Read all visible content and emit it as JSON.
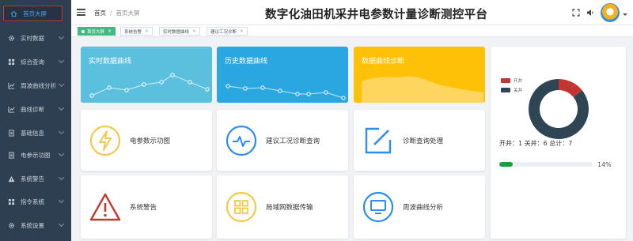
{
  "sidebar": {
    "items": [
      {
        "label": "首页大屏",
        "icon": "home-icon",
        "active": true
      },
      {
        "label": "实时数据",
        "icon": "gear-icon"
      },
      {
        "label": "综合查询",
        "icon": "grid-icon"
      },
      {
        "label": "周波曲线分析",
        "icon": "chart-icon"
      },
      {
        "label": "曲线诊断",
        "icon": "chart-icon"
      },
      {
        "label": "基础信息",
        "icon": "document-icon"
      },
      {
        "label": "电参示功图",
        "icon": "document-icon"
      },
      {
        "label": "系统警告",
        "icon": "warning-icon"
      },
      {
        "label": "指令系统",
        "icon": "grid-icon"
      },
      {
        "label": "系统设置",
        "icon": "gear-icon"
      }
    ]
  },
  "header": {
    "breadcrumb_home": "首页",
    "breadcrumb_sep": "/",
    "breadcrumb_current": "首页大屏",
    "title": "数字化油田机采井电参数计量诊断测控平台"
  },
  "tabs": [
    {
      "label": "首页大屏",
      "active": true
    },
    {
      "label": "系统告警"
    },
    {
      "label": "实时数据曲线"
    },
    {
      "label": "建议工况诊断"
    }
  ],
  "chart_cards": [
    {
      "title": "实时数据曲线",
      "color": "#5bc0de"
    },
    {
      "title": "历史数据曲线",
      "color": "#2aa7e0"
    },
    {
      "title": "数据曲线诊断",
      "color": "#ffc107"
    }
  ],
  "func_cards": [
    {
      "label": "电参数示功图",
      "icon": "lightning-icon",
      "color": "#f2c94c"
    },
    {
      "label": "建议工况诊断查询",
      "icon": "pulse-icon",
      "color": "#2d8cf0"
    },
    {
      "label": "诊断查询处理",
      "icon": "edit-icon",
      "color": "#2d8cf0"
    },
    {
      "label": "系统警告",
      "icon": "warning-icon",
      "color": "#c0392b"
    },
    {
      "label": "局域网数据传输",
      "icon": "grid-icon",
      "color": "#f2c94c"
    },
    {
      "label": "周波曲线分析",
      "icon": "monitor-icon",
      "color": "#2d8cf0"
    }
  ],
  "stats": {
    "legend_open": "开井",
    "legend_closed": "关井",
    "open_color": "#c23531",
    "closed_color": "#2f4554",
    "summary": "开井：1 关井：6 总计：7",
    "progress_label": "14%",
    "progress_value": 0.14
  },
  "chart_data": {
    "type": "pie",
    "categories": [
      "开井",
      "关井"
    ],
    "values": [
      1,
      6
    ]
  }
}
